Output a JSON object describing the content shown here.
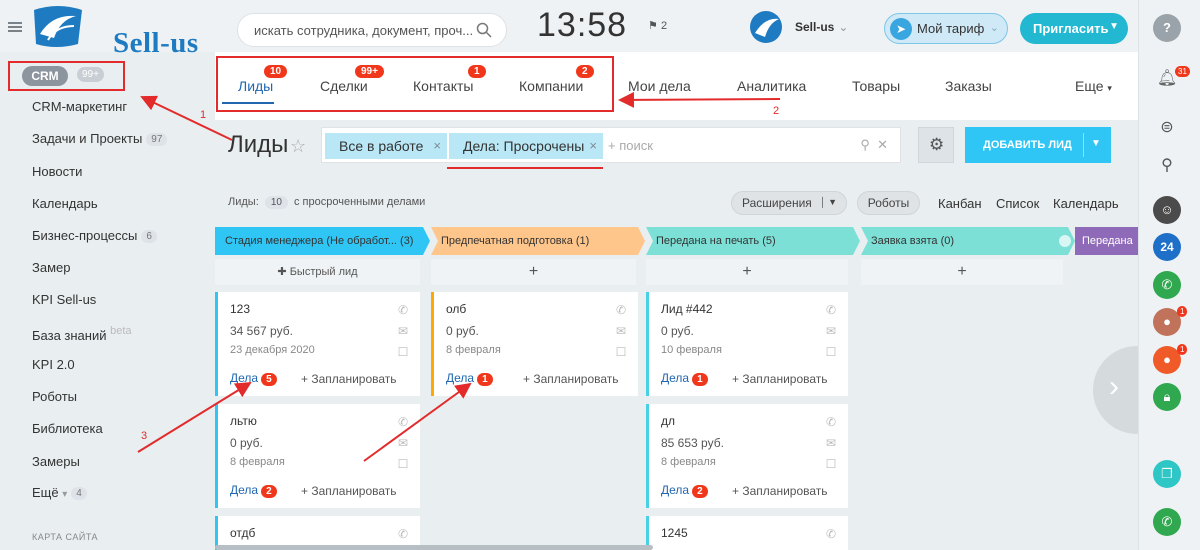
{
  "header": {
    "logo_text": "Sell-us",
    "search_placeholder": "искать сотрудника, документ, проч...",
    "clock": "13:58",
    "flag_count": "2",
    "user_name": "Sell-us",
    "tariff_label": "Мой тариф",
    "invite_label": "Пригласить"
  },
  "sidebar": {
    "crm_label": "CRM",
    "crm_count": "99+",
    "items": [
      {
        "label": "CRM-маркетинг",
        "count": ""
      },
      {
        "label": "Задачи и Проекты",
        "count": "97"
      },
      {
        "label": "Новости",
        "count": ""
      },
      {
        "label": "Календарь",
        "count": ""
      },
      {
        "label": "Бизнес-процессы",
        "count": "6"
      },
      {
        "label": "Замер",
        "count": ""
      },
      {
        "label": "KPI Sell-us",
        "count": ""
      },
      {
        "label": "База знаний",
        "count": ""
      },
      {
        "label": "KPI 2.0",
        "count": ""
      },
      {
        "label": "Роботы",
        "count": ""
      },
      {
        "label": "Библиотека",
        "count": ""
      },
      {
        "label": "Замеры",
        "count": ""
      },
      {
        "label": "Ещё",
        "count": "4"
      }
    ],
    "beta_label": "beta",
    "sitemap_label": "КАРТА САЙТА"
  },
  "tabs": [
    {
      "label": "Лиды",
      "badge": "10"
    },
    {
      "label": "Сделки",
      "badge": "99+"
    },
    {
      "label": "Контакты",
      "badge": "1"
    },
    {
      "label": "Компании",
      "badge": "2"
    },
    {
      "label": "Мои дела",
      "badge": ""
    },
    {
      "label": "Аналитика",
      "badge": ""
    },
    {
      "label": "Товары",
      "badge": ""
    },
    {
      "label": "Заказы",
      "badge": ""
    },
    {
      "label": "Еще",
      "badge": ""
    }
  ],
  "toolbar": {
    "page_title": "Лиды",
    "chip_all": "Все в работе",
    "chip_overdue": "Дела: Просрочены",
    "search_placeholder": "+ поиск",
    "add_label": "ДОБАВИТЬ ЛИД"
  },
  "stats": {
    "prefix": "Лиды:",
    "count": "10",
    "suffix": "с просроченными делами"
  },
  "view": {
    "extensions_label": "Расширения",
    "robots_label": "Роботы",
    "kanban": "Канбан",
    "list": "Список",
    "calendar": "Календарь"
  },
  "stages": [
    {
      "label": "Стадия менеджера (Не обработ...",
      "count": "(3)",
      "color": "#2fc6f6"
    },
    {
      "label": "Предпечатная подготовка",
      "count": "(1)",
      "color": "#ffa900"
    },
    {
      "label": "Передана на печать",
      "count": "(5)",
      "color": "#47d1e2"
    },
    {
      "label": "Заявка взята",
      "count": "(0)",
      "color": "#47d1e2"
    },
    {
      "label": "Передана",
      "count": "",
      "color": "#8f6ab8"
    }
  ],
  "quick_lead_label": "Быстрый лид",
  "cards": {
    "c1": {
      "title": "123",
      "sum": "34 567 руб.",
      "date": "23 декабря 2020",
      "deals": "Дела",
      "badge": "5",
      "plan": "+ Запланировать"
    },
    "c2": {
      "title": "льтю",
      "sum": "0 руб.",
      "date": "8 февраля",
      "deals": "Дела",
      "badge": "2",
      "plan": "+ Запланировать"
    },
    "c3": {
      "title": "отдб"
    },
    "c4": {
      "title": "олб",
      "sum": "0 руб.",
      "date": "8 февраля",
      "deals": "Дела",
      "badge": "1",
      "plan": "+ Запланировать"
    },
    "c5": {
      "title": "Лид #442",
      "sum": "0 руб.",
      "date": "10 февраля",
      "deals": "Дела",
      "badge": "1",
      "plan": "+ Запланировать"
    },
    "c6": {
      "title": "дл",
      "sum": "85 653 руб.",
      "date": "8 февраля",
      "deals": "Дела",
      "badge": "2",
      "plan": "+ Запланировать"
    },
    "c7": {
      "title": "1245"
    }
  },
  "rightbar": {
    "bell_badge": "31",
    "avatar3_badge": "1",
    "avatar4_badge": "1",
    "b24_label": "24"
  },
  "annotations": [
    "1",
    "2",
    "3"
  ]
}
